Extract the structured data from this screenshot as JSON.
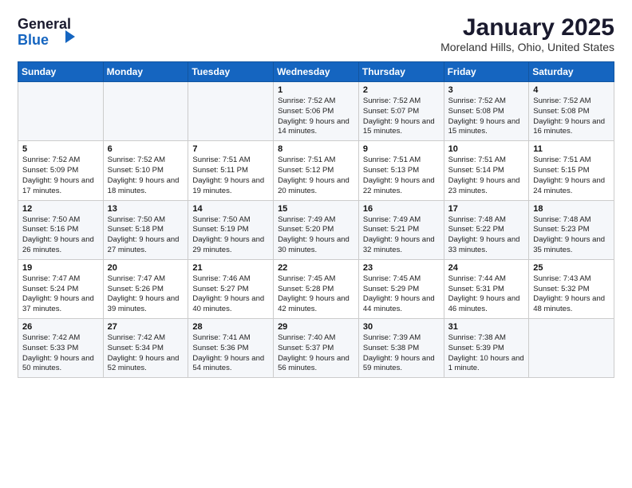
{
  "logo": {
    "line1": "General",
    "line2": "Blue"
  },
  "title": "January 2025",
  "subtitle": "Moreland Hills, Ohio, United States",
  "weekdays": [
    "Sunday",
    "Monday",
    "Tuesday",
    "Wednesday",
    "Thursday",
    "Friday",
    "Saturday"
  ],
  "weeks": [
    [
      {
        "day": "",
        "info": ""
      },
      {
        "day": "",
        "info": ""
      },
      {
        "day": "",
        "info": ""
      },
      {
        "day": "1",
        "info": "Sunrise: 7:52 AM\nSunset: 5:06 PM\nDaylight: 9 hours and 14 minutes."
      },
      {
        "day": "2",
        "info": "Sunrise: 7:52 AM\nSunset: 5:07 PM\nDaylight: 9 hours and 15 minutes."
      },
      {
        "day": "3",
        "info": "Sunrise: 7:52 AM\nSunset: 5:08 PM\nDaylight: 9 hours and 15 minutes."
      },
      {
        "day": "4",
        "info": "Sunrise: 7:52 AM\nSunset: 5:08 PM\nDaylight: 9 hours and 16 minutes."
      }
    ],
    [
      {
        "day": "5",
        "info": "Sunrise: 7:52 AM\nSunset: 5:09 PM\nDaylight: 9 hours and 17 minutes."
      },
      {
        "day": "6",
        "info": "Sunrise: 7:52 AM\nSunset: 5:10 PM\nDaylight: 9 hours and 18 minutes."
      },
      {
        "day": "7",
        "info": "Sunrise: 7:51 AM\nSunset: 5:11 PM\nDaylight: 9 hours and 19 minutes."
      },
      {
        "day": "8",
        "info": "Sunrise: 7:51 AM\nSunset: 5:12 PM\nDaylight: 9 hours and 20 minutes."
      },
      {
        "day": "9",
        "info": "Sunrise: 7:51 AM\nSunset: 5:13 PM\nDaylight: 9 hours and 22 minutes."
      },
      {
        "day": "10",
        "info": "Sunrise: 7:51 AM\nSunset: 5:14 PM\nDaylight: 9 hours and 23 minutes."
      },
      {
        "day": "11",
        "info": "Sunrise: 7:51 AM\nSunset: 5:15 PM\nDaylight: 9 hours and 24 minutes."
      }
    ],
    [
      {
        "day": "12",
        "info": "Sunrise: 7:50 AM\nSunset: 5:16 PM\nDaylight: 9 hours and 26 minutes."
      },
      {
        "day": "13",
        "info": "Sunrise: 7:50 AM\nSunset: 5:18 PM\nDaylight: 9 hours and 27 minutes."
      },
      {
        "day": "14",
        "info": "Sunrise: 7:50 AM\nSunset: 5:19 PM\nDaylight: 9 hours and 29 minutes."
      },
      {
        "day": "15",
        "info": "Sunrise: 7:49 AM\nSunset: 5:20 PM\nDaylight: 9 hours and 30 minutes."
      },
      {
        "day": "16",
        "info": "Sunrise: 7:49 AM\nSunset: 5:21 PM\nDaylight: 9 hours and 32 minutes."
      },
      {
        "day": "17",
        "info": "Sunrise: 7:48 AM\nSunset: 5:22 PM\nDaylight: 9 hours and 33 minutes."
      },
      {
        "day": "18",
        "info": "Sunrise: 7:48 AM\nSunset: 5:23 PM\nDaylight: 9 hours and 35 minutes."
      }
    ],
    [
      {
        "day": "19",
        "info": "Sunrise: 7:47 AM\nSunset: 5:24 PM\nDaylight: 9 hours and 37 minutes."
      },
      {
        "day": "20",
        "info": "Sunrise: 7:47 AM\nSunset: 5:26 PM\nDaylight: 9 hours and 39 minutes."
      },
      {
        "day": "21",
        "info": "Sunrise: 7:46 AM\nSunset: 5:27 PM\nDaylight: 9 hours and 40 minutes."
      },
      {
        "day": "22",
        "info": "Sunrise: 7:45 AM\nSunset: 5:28 PM\nDaylight: 9 hours and 42 minutes."
      },
      {
        "day": "23",
        "info": "Sunrise: 7:45 AM\nSunset: 5:29 PM\nDaylight: 9 hours and 44 minutes."
      },
      {
        "day": "24",
        "info": "Sunrise: 7:44 AM\nSunset: 5:31 PM\nDaylight: 9 hours and 46 minutes."
      },
      {
        "day": "25",
        "info": "Sunrise: 7:43 AM\nSunset: 5:32 PM\nDaylight: 9 hours and 48 minutes."
      }
    ],
    [
      {
        "day": "26",
        "info": "Sunrise: 7:42 AM\nSunset: 5:33 PM\nDaylight: 9 hours and 50 minutes."
      },
      {
        "day": "27",
        "info": "Sunrise: 7:42 AM\nSunset: 5:34 PM\nDaylight: 9 hours and 52 minutes."
      },
      {
        "day": "28",
        "info": "Sunrise: 7:41 AM\nSunset: 5:36 PM\nDaylight: 9 hours and 54 minutes."
      },
      {
        "day": "29",
        "info": "Sunrise: 7:40 AM\nSunset: 5:37 PM\nDaylight: 9 hours and 56 minutes."
      },
      {
        "day": "30",
        "info": "Sunrise: 7:39 AM\nSunset: 5:38 PM\nDaylight: 9 hours and 59 minutes."
      },
      {
        "day": "31",
        "info": "Sunrise: 7:38 AM\nSunset: 5:39 PM\nDaylight: 10 hours and 1 minute."
      },
      {
        "day": "",
        "info": ""
      }
    ]
  ]
}
